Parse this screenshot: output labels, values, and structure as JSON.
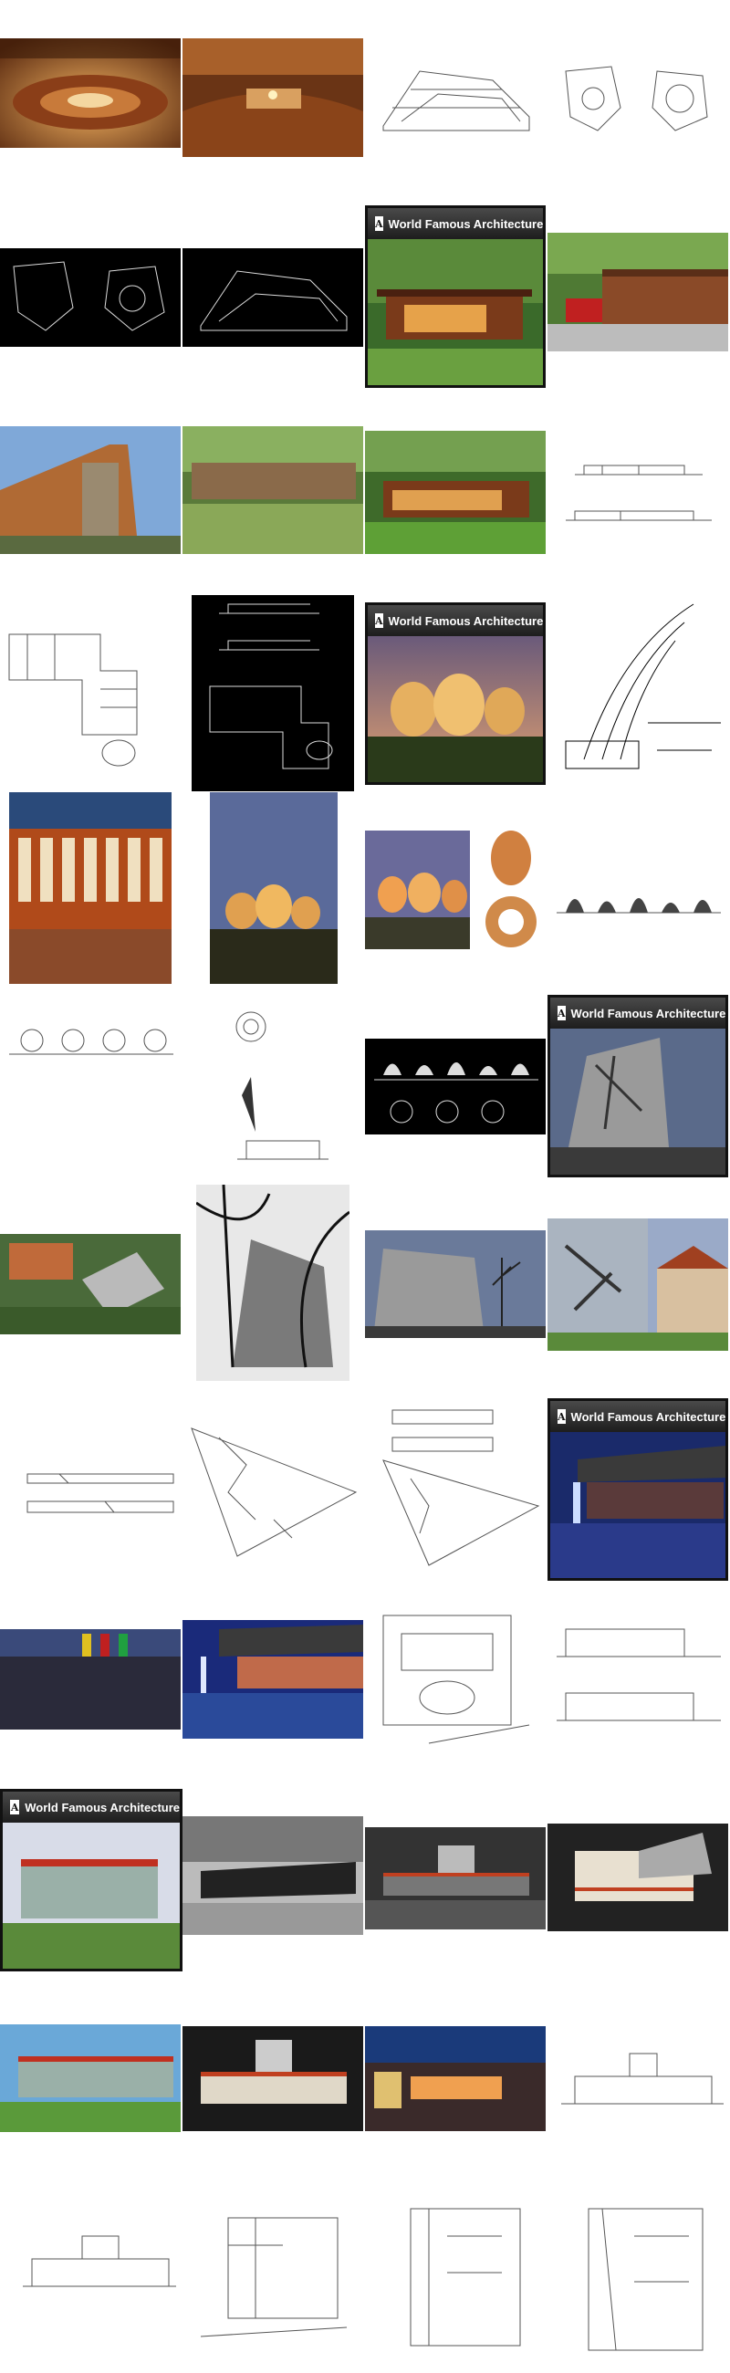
{
  "badge": {
    "title": "World Famous Architecture",
    "logo_char": "A"
  },
  "tiles": [
    {
      "name": "concert-hall-interior-photo-1",
      "kind": "photo"
    },
    {
      "name": "concert-hall-interior-photo-2",
      "kind": "photo"
    },
    {
      "name": "concert-hall-section-drawing",
      "kind": "drawing"
    },
    {
      "name": "concert-hall-plan-drawings",
      "kind": "drawing"
    },
    {
      "name": "concert-hall-plan-dark",
      "kind": "drawing"
    },
    {
      "name": "concert-hall-section-dark",
      "kind": "drawing"
    },
    {
      "name": "wright-house-badge",
      "kind": "badge"
    },
    {
      "name": "wright-house-carport-photo",
      "kind": "photo"
    },
    {
      "name": "wright-house-gable-photo",
      "kind": "photo"
    },
    {
      "name": "wright-house-lawn-photo",
      "kind": "photo"
    },
    {
      "name": "wright-house-exterior-photo",
      "kind": "photo"
    },
    {
      "name": "wright-house-elevations",
      "kind": "drawing"
    },
    {
      "name": "wright-house-plan",
      "kind": "drawing"
    },
    {
      "name": "wright-house-plans-dark",
      "kind": "drawing"
    },
    {
      "name": "domes-badge",
      "kind": "badge"
    },
    {
      "name": "domes-sketch",
      "kind": "drawing"
    },
    {
      "name": "domes-interior-photo",
      "kind": "photo"
    },
    {
      "name": "domes-dusk-photo",
      "kind": "photo"
    },
    {
      "name": "domes-model-photo",
      "kind": "photo"
    },
    {
      "name": "domes-elevation",
      "kind": "drawing"
    },
    {
      "name": "domes-section-drawing",
      "kind": "drawing"
    },
    {
      "name": "domes-detail-drawing",
      "kind": "drawing"
    },
    {
      "name": "domes-section-dark",
      "kind": "drawing"
    },
    {
      "name": "jewish-museum-badge",
      "kind": "badge"
    },
    {
      "name": "jewish-museum-aerial-photo",
      "kind": "photo"
    },
    {
      "name": "jewish-museum-tree-photo",
      "kind": "photo"
    },
    {
      "name": "jewish-museum-street-photo",
      "kind": "photo"
    },
    {
      "name": "jewish-museum-facade-photo",
      "kind": "photo"
    },
    {
      "name": "jewish-museum-elevations",
      "kind": "drawing"
    },
    {
      "name": "jewish-museum-plan-1",
      "kind": "drawing"
    },
    {
      "name": "jewish-museum-plan-2",
      "kind": "drawing"
    },
    {
      "name": "lucerne-badge",
      "kind": "badge"
    },
    {
      "name": "lucerne-flags-photo",
      "kind": "photo"
    },
    {
      "name": "lucerne-night-photo",
      "kind": "photo"
    },
    {
      "name": "lucerne-plan",
      "kind": "drawing"
    },
    {
      "name": "lucerne-sections",
      "kind": "drawing"
    },
    {
      "name": "glass-house-badge",
      "kind": "badge"
    },
    {
      "name": "glass-house-bw-photo",
      "kind": "photo"
    },
    {
      "name": "glass-house-model-dark",
      "kind": "photo"
    },
    {
      "name": "glass-house-model-light",
      "kind": "photo"
    },
    {
      "name": "glass-house-canopy-photo",
      "kind": "photo"
    },
    {
      "name": "glass-house-model-photo",
      "kind": "photo"
    },
    {
      "name": "glass-house-night-photo",
      "kind": "photo"
    },
    {
      "name": "glass-house-elevation",
      "kind": "drawing"
    },
    {
      "name": "glass-house-section",
      "kind": "drawing"
    },
    {
      "name": "glass-house-plan-1",
      "kind": "drawing"
    },
    {
      "name": "glass-house-plan-2",
      "kind": "drawing"
    },
    {
      "name": "glass-house-plan-3",
      "kind": "drawing"
    }
  ]
}
